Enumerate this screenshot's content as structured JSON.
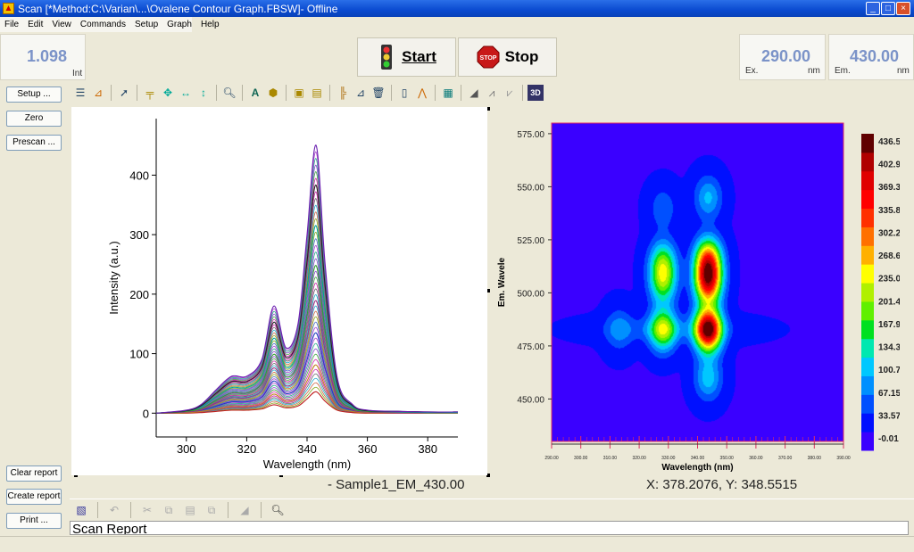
{
  "window": {
    "title": "Scan [*Method:C:\\Varian\\...\\Ovalene Contour Graph.FBSW]- Offline",
    "controls": [
      "_",
      "□",
      "×"
    ]
  },
  "menu": [
    "File",
    "Edit",
    "View",
    "Commands",
    "Setup",
    "Graph",
    "Help"
  ],
  "readouts": {
    "intensity": {
      "value": "1.098",
      "unit": "Int"
    },
    "ex": {
      "label": "Ex.",
      "value": "290.00",
      "unit": "nm"
    },
    "em": {
      "label": "Em.",
      "value": "430.00",
      "unit": "nm"
    }
  },
  "buttons": {
    "start": "Start",
    "stop": "Stop",
    "setup": "Setup ...",
    "zero": "Zero",
    "prescan": "Prescan ...",
    "clear_report": "Clear report",
    "create_report": "Create report",
    "print": "Print ..."
  },
  "toolbar_icons": [
    "overlay-icon",
    "graph-preferences-icon",
    "pointer-icon",
    "cursor-icon",
    "move-icon",
    "horizontal-scale-icon",
    "vertical-scale-icon",
    "zoom-icon",
    "text-icon",
    "label-peaks-icon",
    "autoscale-icon",
    "autoscale-y-icon",
    "add-trace-icon",
    "remove-trace-icon",
    "delete-icon",
    "trace-info-icon",
    "peak-find-icon",
    "calculator-icon",
    "3d-surface-icon",
    "smooth-icon",
    "derivative-icon",
    "3d-view-icon"
  ],
  "report": {
    "text": "Scan Report",
    "toolbar_icons": [
      "edit-icon",
      "undo-icon",
      "cut-icon",
      "copy-icon",
      "paste-icon",
      "paste-special-icon",
      "font-icon",
      "print-preview-icon"
    ]
  },
  "captions": {
    "left": "- Sample1_EM_430.00",
    "right": "X: 378.2076, Y: 348.5515"
  },
  "chart_data": [
    {
      "type": "line",
      "xlabel": "Wavelength (nm)",
      "ylabel": "Intensity (a.u.)",
      "xlim": [
        290,
        390
      ],
      "ylim": [
        -40,
        495
      ],
      "xticks": [
        300,
        320,
        340,
        360,
        380
      ],
      "yticks": [
        0,
        100,
        200,
        300,
        400
      ],
      "x": [
        290,
        300,
        305,
        310,
        315,
        320,
        325,
        329,
        333,
        337,
        340,
        343,
        346,
        350,
        355,
        360,
        370,
        380,
        390
      ],
      "series": [
        {
          "color": "#6a1fb0",
          "values": [
            0,
            5,
            15,
            40,
            62,
            62,
            90,
            180,
            110,
            150,
            300,
            450,
            250,
            60,
            15,
            5,
            3,
            2,
            2
          ]
        },
        {
          "color": "#222222",
          "values": [
            0,
            4,
            13,
            34,
            53,
            53,
            77,
            153,
            94,
            128,
            255,
            383,
            213,
            51,
            13,
            4,
            3,
            2,
            2
          ]
        },
        {
          "color": "#00a0a0",
          "values": [
            0,
            4,
            11,
            28,
            43,
            43,
            63,
            126,
            77,
            105,
            210,
            315,
            175,
            42,
            11,
            4,
            2,
            1,
            1
          ]
        },
        {
          "color": "#30a030",
          "values": [
            0,
            3,
            8,
            22,
            34,
            34,
            50,
            99,
            61,
            83,
            165,
            248,
            138,
            33,
            8,
            3,
            2,
            1,
            1
          ]
        },
        {
          "color": "#a03080",
          "values": [
            0,
            2,
            6,
            17,
            26,
            26,
            38,
            76,
            46,
            63,
            126,
            189,
            105,
            25,
            6,
            2,
            1,
            1,
            1
          ]
        },
        {
          "color": "#2040c0",
          "values": [
            0,
            2,
            5,
            12,
            19,
            19,
            27,
            54,
            33,
            45,
            90,
            135,
            75,
            18,
            5,
            2,
            1,
            1,
            1
          ]
        },
        {
          "color": "#c08020",
          "values": [
            0,
            1,
            3,
            7,
            11,
            11,
            16,
            32,
            20,
            27,
            54,
            81,
            45,
            11,
            3,
            1,
            1,
            0,
            0
          ]
        },
        {
          "color": "#c02020",
          "values": [
            0,
            0,
            1,
            3,
            5,
            5,
            7,
            14,
            9,
            12,
            24,
            36,
            20,
            5,
            1,
            0,
            0,
            0,
            0
          ]
        }
      ]
    },
    {
      "type": "heatmap",
      "xlabel": "Wavelength (nm)",
      "ylabel": "Em. Wavele",
      "xlim": [
        290,
        390
      ],
      "ylim": [
        430,
        580
      ],
      "xticks": [
        "290.00",
        "300.00",
        "310.00",
        "320.00",
        "330.00",
        "340.00",
        "350.00",
        "360.00",
        "370.00",
        "380.00",
        "390.00"
      ],
      "yticks": [
        "450.00",
        "475.00",
        "500.00",
        "525.00",
        "550.00",
        "575.00"
      ],
      "colorbar": {
        "levels": [
          "436.56",
          "402.97",
          "369.39",
          "335.81",
          "302.23",
          "268.64",
          "235.06",
          "201.48",
          "167.90",
          "134.32",
          "100.73",
          "67.15",
          "33.57",
          "-0.01"
        ],
        "colors": [
          "#3a00ff",
          "#0010ff",
          "#0050ff",
          "#0090ff",
          "#00c8ff",
          "#00e8b0",
          "#00e020",
          "#60f000",
          "#b0f000",
          "#ffff00",
          "#ffb000",
          "#ff7000",
          "#ff3000",
          "#ff0000",
          "#e00000",
          "#b00000",
          "#600000"
        ]
      },
      "peaks": [
        {
          "ex": 343.5,
          "em": 483,
          "value": 436
        },
        {
          "ex": 343.5,
          "em": 505,
          "value": 330
        },
        {
          "ex": 343.5,
          "em": 516,
          "value": 280
        },
        {
          "ex": 328,
          "em": 483,
          "value": 200
        },
        {
          "ex": 328,
          "em": 505,
          "value": 160
        },
        {
          "ex": 328,
          "em": 515,
          "value": 150
        },
        {
          "ex": 343.5,
          "em": 545,
          "value": 90
        },
        {
          "ex": 343.5,
          "em": 460,
          "value": 100
        },
        {
          "ex": 328,
          "em": 540,
          "value": 50
        },
        {
          "ex": 313,
          "em": 483,
          "value": 60
        }
      ]
    }
  ]
}
